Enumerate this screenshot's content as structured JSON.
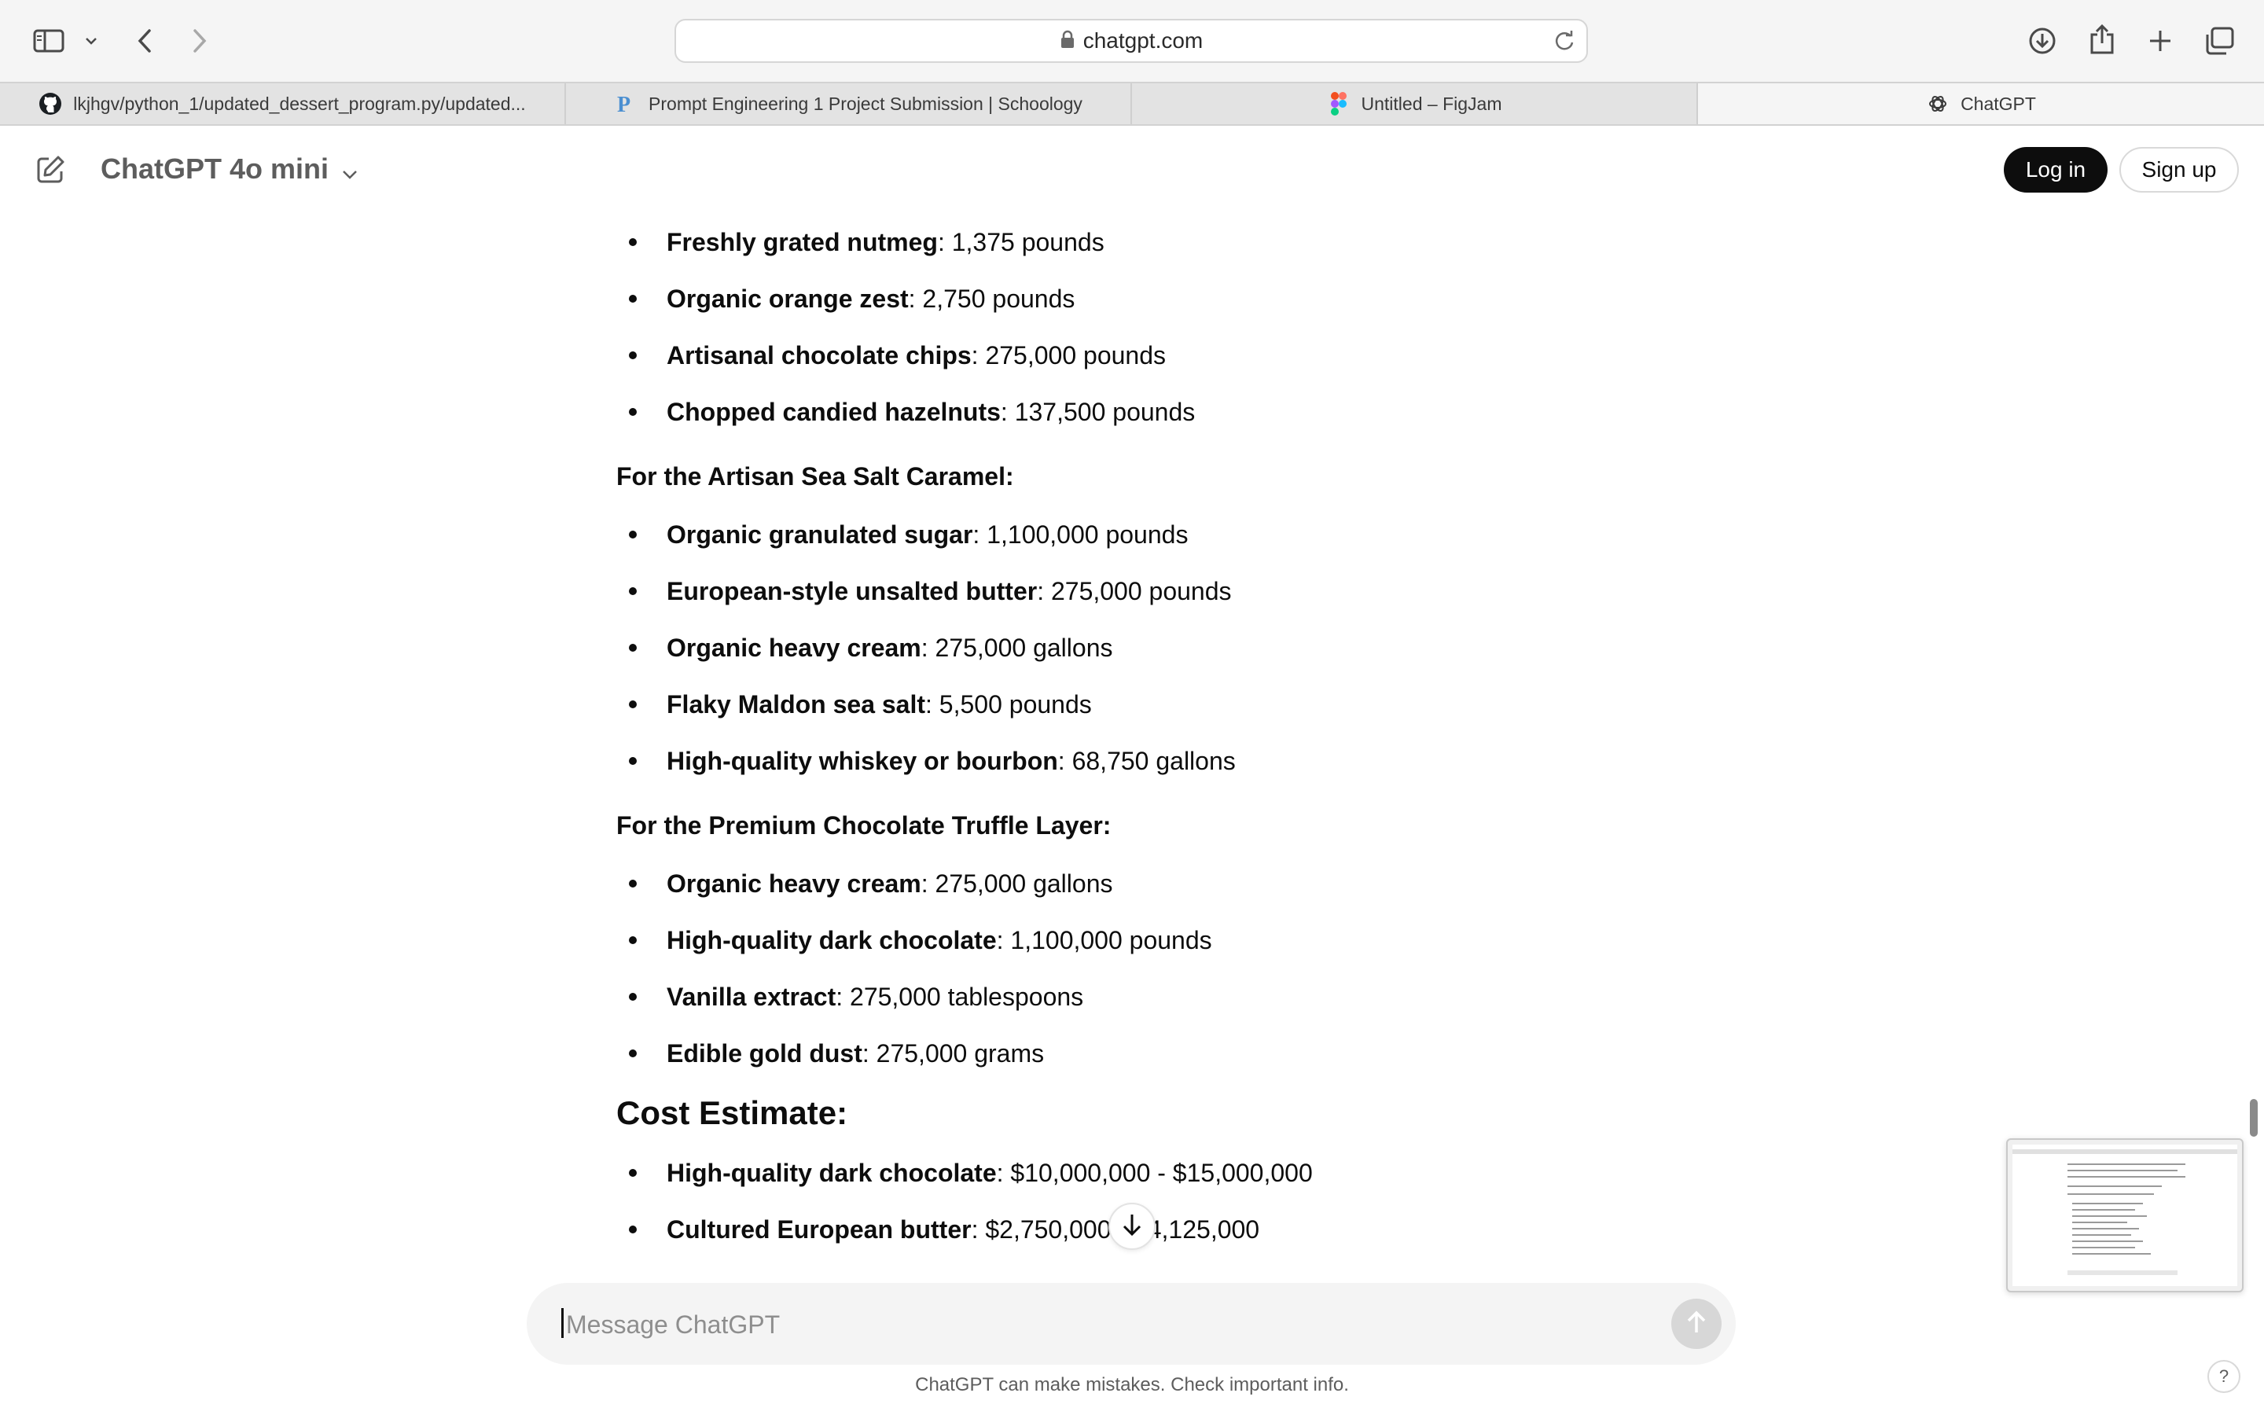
{
  "browser": {
    "url": "chatgpt.com",
    "tabs": [
      {
        "label": "lkjhgv/python_1/updated_dessert_program.py/updated...",
        "icon": "github-icon"
      },
      {
        "label": "Prompt Engineering 1 Project Submission | Schoology",
        "icon": "schoology-icon"
      },
      {
        "label": "Untitled – FigJam",
        "icon": "figma-icon"
      },
      {
        "label": "ChatGPT",
        "icon": "openai-icon",
        "active": true
      }
    ]
  },
  "header": {
    "model": "ChatGPT 4o mini",
    "login_label": "Log in",
    "signup_label": "Sign up"
  },
  "content": {
    "list1": [
      {
        "name": "Freshly grated nutmeg",
        "value": ": 1,375 pounds"
      },
      {
        "name": "Organic orange zest",
        "value": ": 2,750 pounds"
      },
      {
        "name": "Artisanal chocolate chips",
        "value": ": 275,000 pounds"
      },
      {
        "name": "Chopped candied hazelnuts",
        "value": ": 137,500 pounds"
      }
    ],
    "section_caramel": "For the Artisan Sea Salt Caramel:",
    "list_caramel": [
      {
        "name": "Organic granulated sugar",
        "value": ": 1,100,000 pounds"
      },
      {
        "name": "European-style unsalted butter",
        "value": ": 275,000 pounds"
      },
      {
        "name": "Organic heavy cream",
        "value": ": 275,000 gallons"
      },
      {
        "name": "Flaky Maldon sea salt",
        "value": ": 5,500 pounds"
      },
      {
        "name": "High-quality whiskey or bourbon",
        "value": ": 68,750 gallons"
      }
    ],
    "section_truffle": "For the Premium Chocolate Truffle Layer:",
    "list_truffle": [
      {
        "name": "Organic heavy cream",
        "value": ": 275,000 gallons"
      },
      {
        "name": "High-quality dark chocolate",
        "value": ": 1,100,000 pounds"
      },
      {
        "name": "Vanilla extract",
        "value": ": 275,000 tablespoons"
      },
      {
        "name": "Edible gold dust",
        "value": ": 275,000 grams"
      }
    ],
    "cost_heading": "Cost Estimate:",
    "list_cost": [
      {
        "name": "High-quality dark chocolate",
        "value": ": $10,000,000 - $15,000,000"
      },
      {
        "name": "Cultured European butter",
        "value": ": $2,750,000 - $4,125,000"
      }
    ]
  },
  "composer": {
    "placeholder": "Message ChatGPT",
    "disclaimer": "ChatGPT can make mistakes. Check important info.",
    "help_label": "?"
  },
  "colors": {
    "login_bg": "#0d0d0d",
    "toolbar_bg": "#f5f5f5",
    "tabbar_bg": "#e3e3e3"
  }
}
